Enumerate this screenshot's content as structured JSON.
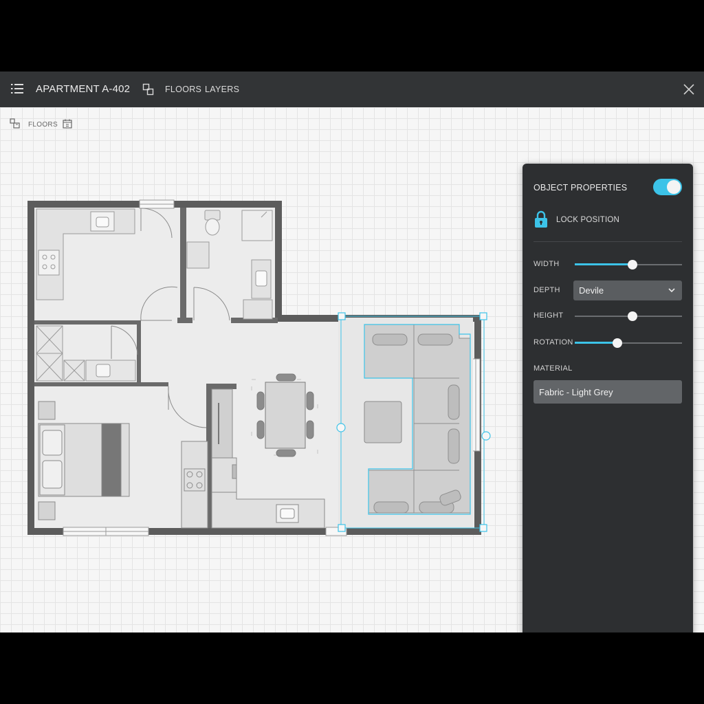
{
  "header": {
    "title": "APARTMENT A-402",
    "tabs": [
      {
        "label": "FLOORS",
        "icon": "floors-icon"
      },
      {
        "label": "LAYERS"
      }
    ],
    "menu_icon": "menu-icon",
    "close_icon": "close-icon"
  },
  "subtoolbar": {
    "label": "FLOORS",
    "icons": [
      "floor-plan-icon",
      "calendar-icon"
    ]
  },
  "properties": {
    "title": "OBJECT PROPERTIES",
    "enabled": true,
    "lock_label": "LOCK POSITION",
    "width": {
      "label": "WIDTH",
      "value": 0.54
    },
    "depth": {
      "label": "DEPTH",
      "value": "Devile"
    },
    "height": {
      "label": "HEIGHT",
      "value": 0.54
    },
    "rotation": {
      "label": "ROTATION",
      "value": 0.4
    },
    "material": {
      "label": "MATERIAL",
      "value": "Fabric - Light Grey"
    }
  },
  "colors": {
    "accent": "#3cc3e8",
    "panel": "#2d2f31",
    "topbar": "#323436",
    "wall": "#5c5c5c"
  }
}
